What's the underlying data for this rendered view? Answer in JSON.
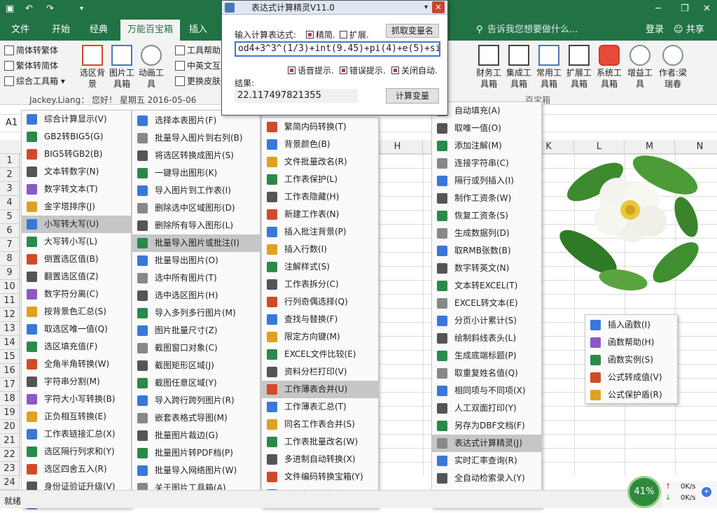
{
  "titlebar": {
    "save_icon": "save-icon",
    "undo_icon": "undo-icon",
    "redo_icon": "redo-icon"
  },
  "ribbon_tabs": [
    "文件",
    "开始",
    "经典",
    "万能百宝箱",
    "插入"
  ],
  "tell_me": "告诉我您想要做什么...",
  "login": "登录",
  "share": "共享",
  "ribbon": {
    "small_left": [
      "简体转繁体",
      "繁体转简体",
      "综合工具箱"
    ],
    "big_left": [
      {
        "label1": "选区背",
        "label2": "景",
        "icon": "select-bg-icon"
      },
      {
        "label1": "图片工",
        "label2": "具箱",
        "icon": "picture-icon"
      },
      {
        "label1": "动画工",
        "label2": "具",
        "icon": "animation-icon"
      }
    ],
    "small_mid": [
      "工具帮助",
      "中英文互",
      "更换皮肤"
    ],
    "big_right": [
      {
        "label1": "财务工",
        "label2": "具箱"
      },
      {
        "label1": "集成工",
        "label2": "具箱"
      },
      {
        "label1": "常用工",
        "label2": "具箱"
      },
      {
        "label1": "扩展工",
        "label2": "具箱"
      },
      {
        "label1": "系统工",
        "label2": "具箱"
      },
      {
        "label1": "增益工",
        "label2": "具"
      },
      {
        "label1": "作者:梁",
        "label2": "瑞春"
      }
    ],
    "group_label": "百宝箱",
    "info_line": "Jackey.Liang：  您好！  星期五   2016-05-06"
  },
  "namebox": "A1",
  "columns": [
    "H",
    "K",
    "L",
    "M",
    "N"
  ],
  "rows": [
    "1",
    "2",
    "3",
    "4",
    "5",
    "6",
    "7",
    "8",
    "9",
    "10",
    "11",
    "12",
    "13",
    "14",
    "15",
    "16",
    "17",
    "18",
    "19",
    "20",
    "21",
    "22",
    "23",
    "24"
  ],
  "menu1": [
    "综合计算显示(V)",
    "GB2转BIG5(G)",
    "BIG5转GB2(B)",
    "文本转数字(N)",
    "数字转文本(T)",
    "金字塔排序(J)",
    "小写转大写(U)",
    "大写转小写(L)",
    "倒置选区值(B)",
    "翻置选区值(Z)",
    "数字符分离(C)",
    "按背景色汇总(S)",
    "取选区唯一值(Q)",
    "选区填充值(F)",
    "全角半角转换(W)",
    "字符串分割(M)",
    "字符大小写转换(B)",
    "正负相互转换(E)",
    "工作表链接汇总(X)",
    "选区隔行列求和(Y)",
    "选区四舍五入(R)",
    "身份证验证升级(V)",
    "多国语言互译(M)"
  ],
  "menu2": [
    "选择本表图片(F)",
    "批量导入图片到右列(B)",
    "将选区转换成图片(S)",
    "一键导出图形(K)",
    "导入图片到工作表(I)",
    "删除选中区域图形(D)",
    "删除所有导入图形(L)",
    "批量导入图片或批注(I)",
    "批量导出图片(O)",
    "选中所有图片(T)",
    "选中选区图片(H)",
    "导入多列多行图片(M)",
    "图片批量尺寸(Z)",
    "截图窗口对象(C)",
    "截图矩形区域(J)",
    "截图任意区域(Y)",
    "导入跨行跨列图片(R)",
    "嵌套表格式导图(M)",
    "批量图片裁边(G)",
    "批量图片转PDF档(P)",
    "批量导入网络图片(W)",
    "关于图片工具箱(A)"
  ],
  "menu3": [
    "繁简内码转换(T)",
    "背景颜色(B)",
    "文件批量改名(R)",
    "工作表保护(L)",
    "工作表隐藏(H)",
    "新建工作表(N)",
    "插入批注背景(P)",
    "插入行数(I)",
    "注解样式(S)",
    "工作表拆分(C)",
    "行列奇偶选择(Q)",
    "查找与替换(F)",
    "限定方向键(M)",
    "EXCEL文件比较(E)",
    "资料分栏打印(V)",
    "工作薄表合并(U)",
    "工作薄表汇总(T)",
    "同名工作表合并(S)",
    "工作表批量改名(W)",
    "多进制自动转换(X)",
    "文件编码转换宝箱(Y)",
    "工作表查找排序(Z)"
  ],
  "menu4": [
    "自动填充(A)",
    "取唯一值(O)",
    "添加注解(M)",
    "连接字符串(C)",
    "隔行或列插入(I)",
    "制作工资条(W)",
    "恢复工资条(S)",
    "生成数据列(D)",
    "取RMB张数(B)",
    "数字转英文(N)",
    "文本转EXCEL(T)",
    "EXCEL转文本(E)",
    "分页小计累计(S)",
    "绘制斜线表头(L)",
    "生成底端标题(P)",
    "取重复姓名值(Q)",
    "相同项与不同项(X)",
    "人工双面打印(Y)",
    "另存为DBF文档(F)",
    "表达式计算精灵(J)",
    "实时汇率查询(R)",
    "全自动检索录入(Y)",
    "百宝箱大本营(Z)"
  ],
  "menu5": [
    "插入函数(I)",
    "函数帮助(H)",
    "函数实例(S)",
    "公式转成值(V)",
    "公式保护盾(R)"
  ],
  "dialog": {
    "title": "表达式计算精灵V11.0",
    "input_label": "输入计算表达式:",
    "cb_simple": "精简.",
    "cb_extend": "扩展.",
    "grab_button": "抓取变量名",
    "expression": "od4+3^3^(1/3)+int(9.45)+pi(4)+e(5)+sin1-cos2",
    "cb_voice": "语音提示.",
    "cb_error": "错误提示.",
    "cb_autoclose": "关闭自动.",
    "result_label": "结果:",
    "result_value": "22.117497821355",
    "calc_button": "计算变量"
  },
  "status": {
    "ready": "就绪",
    "cpu": "41%",
    "net_up": "0K/s",
    "net_down": "0K/s"
  },
  "colors": {
    "excel_green": "#217346",
    "highlight": "#c6c6c6",
    "checkbox_mark": "#c0316e"
  }
}
